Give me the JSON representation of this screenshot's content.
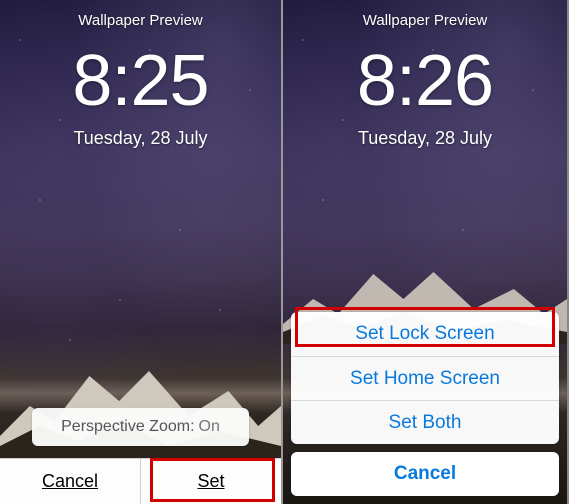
{
  "left": {
    "header": "Wallpaper Preview",
    "time": "8:25",
    "date": "Tuesday, 28 July",
    "perspective_label": "Perspective Zoom: ",
    "perspective_value": "On",
    "cancel": "Cancel",
    "set": "Set"
  },
  "right": {
    "header": "Wallpaper Preview",
    "time": "8:26",
    "date": "Tuesday, 28 July",
    "sheet": {
      "set_lock": "Set Lock Screen",
      "set_home": "Set Home Screen",
      "set_both": "Set Both",
      "cancel": "Cancel"
    }
  }
}
